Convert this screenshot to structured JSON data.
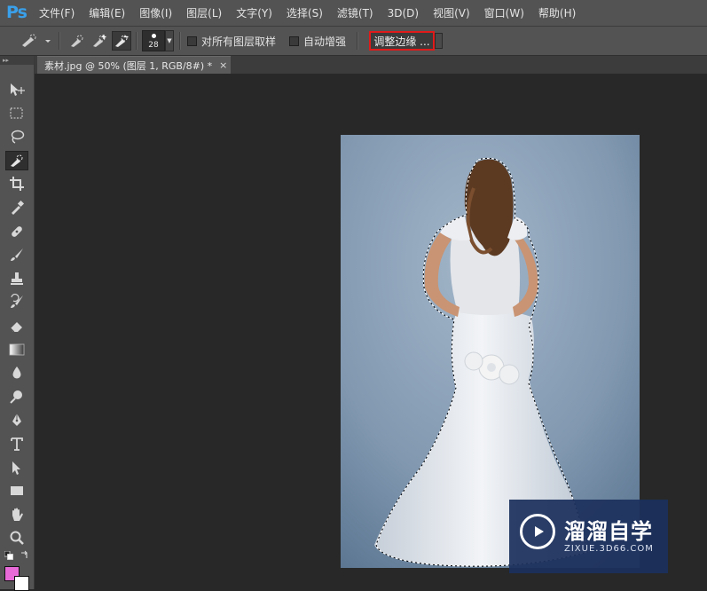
{
  "app": {
    "logo": "Ps"
  },
  "menu": {
    "items": [
      "文件(F)",
      "编辑(E)",
      "图像(I)",
      "图层(L)",
      "文字(Y)",
      "选择(S)",
      "滤镜(T)",
      "3D(D)",
      "视图(V)",
      "窗口(W)",
      "帮助(H)"
    ]
  },
  "options": {
    "brush_size": "28",
    "sample_all_layers": "对所有图层取样",
    "auto_enhance": "自动增强",
    "refine_edge": "调整边缘 ..."
  },
  "document": {
    "tab_title": "素材.jpg @ 50% (图层 1, RGB/8#) *",
    "close_glyph": "×"
  },
  "colors": {
    "foreground": "#e86ad8",
    "background": "#ffffff",
    "highlight": "#e01a1a",
    "ui_panel": "#535353",
    "canvas": "#282828"
  },
  "tools": [
    "move-tool",
    "marquee-tool",
    "lasso-tool",
    "quick-selection-tool",
    "crop-tool",
    "eyedropper-tool",
    "healing-brush-tool",
    "brush-tool",
    "clone-stamp-tool",
    "history-brush-tool",
    "eraser-tool",
    "gradient-tool",
    "blur-tool",
    "dodge-tool",
    "pen-tool",
    "type-tool",
    "path-selection-tool",
    "rectangle-tool",
    "hand-tool",
    "zoom-tool"
  ],
  "watermark": {
    "title": "溜溜自学",
    "subtitle": "ZIXUE.3D66.COM"
  }
}
